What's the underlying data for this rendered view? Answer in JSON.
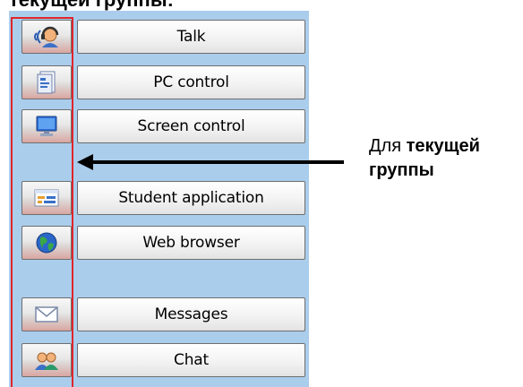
{
  "heading_fragment": "текущей группы:",
  "buttons": [
    {
      "label": "Talk",
      "icon": "headset-icon"
    },
    {
      "label": "PC control",
      "icon": "document-icon"
    },
    {
      "label": "Screen control",
      "icon": "monitor-icon"
    },
    {
      "label": "Student application",
      "icon": "application-window-icon"
    },
    {
      "label": "Web browser",
      "icon": "globe-icon"
    },
    {
      "label": "Messages",
      "icon": "envelope-icon"
    },
    {
      "label": "Chat",
      "icon": "people-icon"
    }
  ],
  "callout": {
    "prefix": "Для ",
    "bold_line1": "текущей",
    "bold_line2": "группы"
  },
  "colors": {
    "panel_background": "#aacdec",
    "highlight_frame": "#e0262a",
    "arrow": "#000000"
  }
}
